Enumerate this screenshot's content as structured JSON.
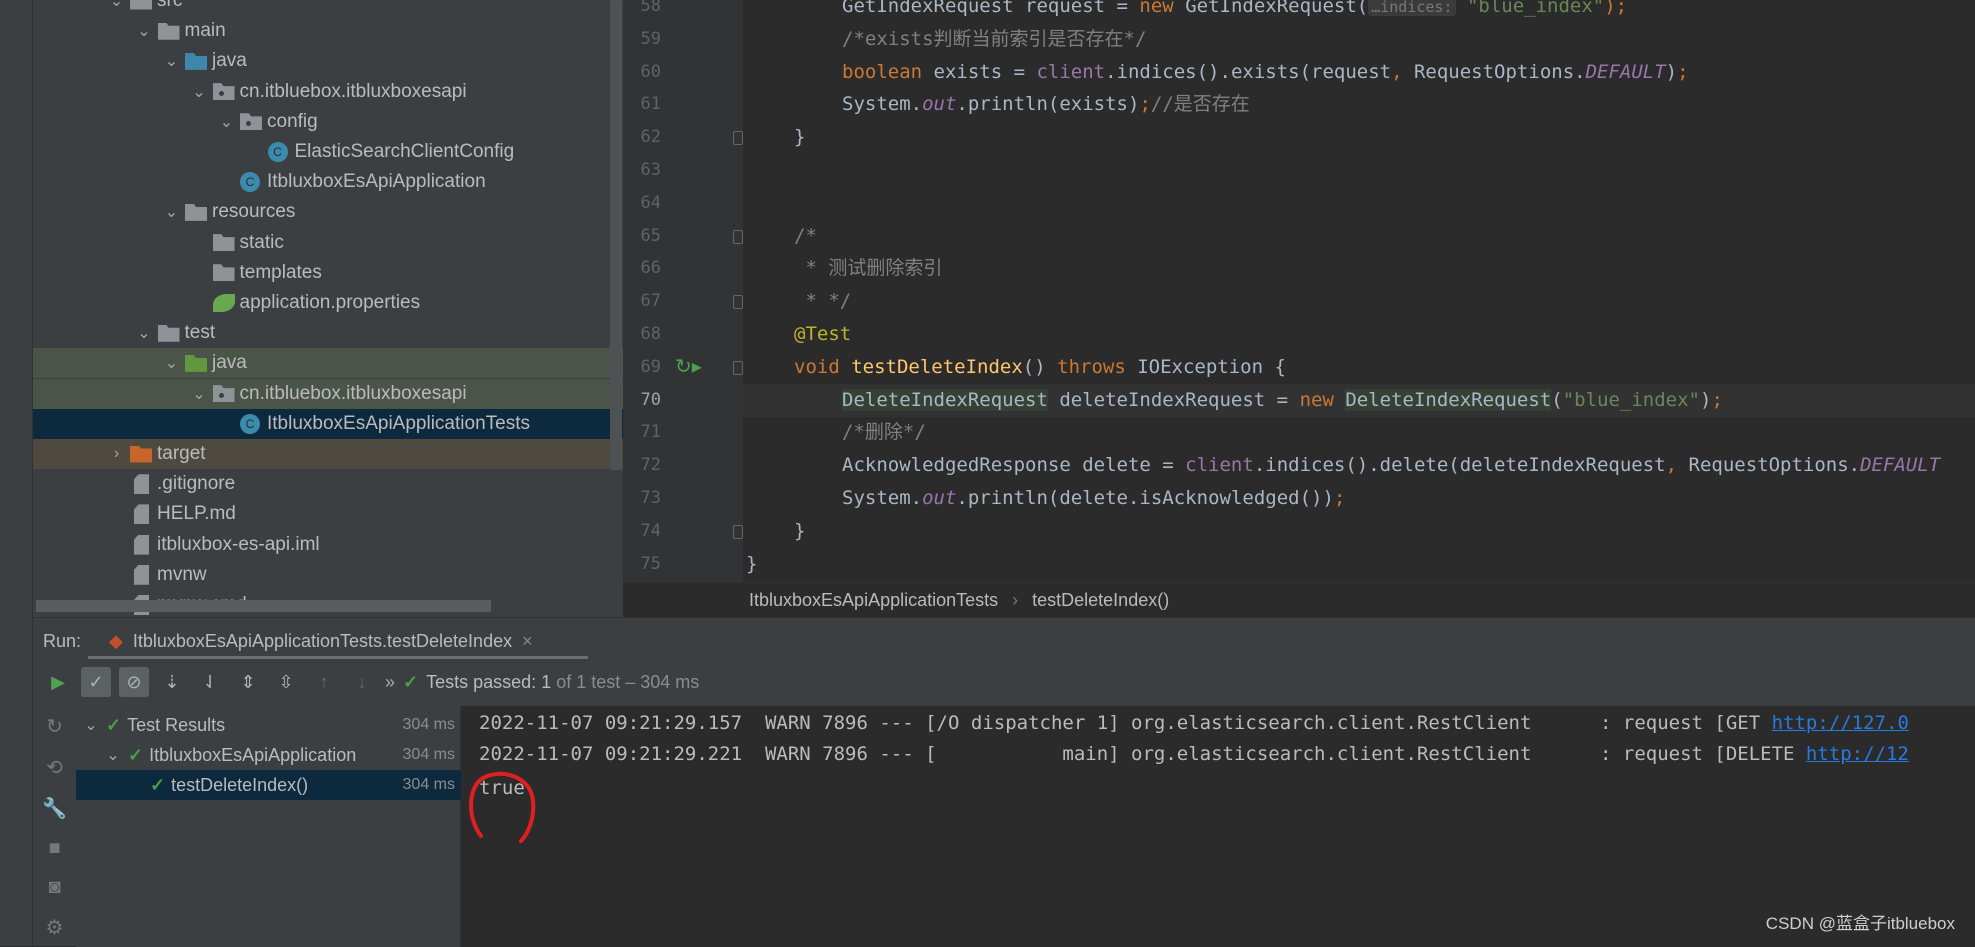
{
  "project_tree": [
    {
      "label": "src",
      "level": 0,
      "expand": "open",
      "icon": "folder"
    },
    {
      "label": "main",
      "level": 1,
      "expand": "open",
      "icon": "folder"
    },
    {
      "label": "java",
      "level": 2,
      "expand": "open",
      "icon": "folder-blue"
    },
    {
      "label": "cn.itbluebox.itbluxboxesapi",
      "level": 3,
      "expand": "open",
      "icon": "package"
    },
    {
      "label": "config",
      "level": 4,
      "expand": "open",
      "icon": "package"
    },
    {
      "label": "ElasticSearchClientConfig",
      "level": 5,
      "expand": "none",
      "icon": "class"
    },
    {
      "label": "ItbluxboxEsApiApplication",
      "level": 4,
      "expand": "none",
      "icon": "class"
    },
    {
      "label": "resources",
      "level": 2,
      "expand": "open",
      "icon": "folder"
    },
    {
      "label": "static",
      "level": 3,
      "expand": "none",
      "icon": "folder"
    },
    {
      "label": "templates",
      "level": 3,
      "expand": "none",
      "icon": "folder"
    },
    {
      "label": "application.properties",
      "level": 3,
      "expand": "none",
      "icon": "spring"
    },
    {
      "label": "test",
      "level": 1,
      "expand": "open",
      "icon": "folder"
    },
    {
      "label": "java",
      "level": 2,
      "expand": "open",
      "icon": "folder-green",
      "highlight": "green"
    },
    {
      "label": "cn.itbluebox.itbluxboxesapi",
      "level": 3,
      "expand": "open",
      "icon": "package",
      "highlight": "green"
    },
    {
      "label": "ItbluxboxEsApiApplicationTests",
      "level": 4,
      "expand": "none",
      "icon": "class",
      "highlight": "sel"
    },
    {
      "label": "target",
      "level": 0,
      "expand": "closed",
      "icon": "folder-orange",
      "highlight": "excl"
    },
    {
      "label": ".gitignore",
      "level": 0,
      "expand": "none",
      "icon": "file"
    },
    {
      "label": "HELP.md",
      "level": 0,
      "expand": "none",
      "icon": "file"
    },
    {
      "label": "itbluxbox-es-api.iml",
      "level": 0,
      "expand": "none",
      "icon": "file"
    },
    {
      "label": "mvnw",
      "level": 0,
      "expand": "none",
      "icon": "file"
    },
    {
      "label": "mvnw.cmd",
      "level": 0,
      "expand": "none",
      "icon": "file"
    }
  ],
  "editor": {
    "current_line": 70,
    "lines": [
      {
        "n": 58,
        "indent": 2,
        "tokens": [
          [
            "GetIndexRequest request = ",
            ""
          ],
          [
            "new ",
            "kw"
          ],
          [
            "GetIndexRequest(",
            ""
          ],
          [
            "…indices:",
            "hint"
          ],
          [
            " ",
            ""
          ],
          [
            "\"blue_index\"",
            "str"
          ],
          [
            ");",
            "kw"
          ]
        ]
      },
      {
        "n": 59,
        "indent": 2,
        "tokens": [
          [
            "/*exists判断当前索引是否存在*/",
            "cm"
          ]
        ]
      },
      {
        "n": 60,
        "indent": 2,
        "tokens": [
          [
            "boolean ",
            "kw"
          ],
          [
            "exists = ",
            ""
          ],
          [
            "client",
            "fld"
          ],
          [
            ".indices().exists(request",
            ""
          ],
          [
            ", ",
            "kw"
          ],
          [
            "RequestOptions.",
            ""
          ],
          [
            "DEFAULT",
            "fldi"
          ],
          [
            ")",
            ""
          ],
          [
            ";",
            "kw"
          ]
        ]
      },
      {
        "n": 61,
        "indent": 2,
        "tokens": [
          [
            "System.",
            ""
          ],
          [
            "out",
            "fldi"
          ],
          [
            ".println(exists)",
            ""
          ],
          [
            ";",
            "kw"
          ],
          [
            "//是否存在",
            "cm"
          ]
        ]
      },
      {
        "n": 62,
        "indent": 1,
        "fold": true,
        "tokens": [
          [
            "}",
            ""
          ]
        ]
      },
      {
        "n": 63,
        "indent": 0,
        "tokens": []
      },
      {
        "n": 64,
        "indent": 0,
        "tokens": []
      },
      {
        "n": 65,
        "indent": 1,
        "fold": true,
        "tokens": [
          [
            "/*",
            "cm"
          ]
        ]
      },
      {
        "n": 66,
        "indent": 1,
        "tokens": [
          [
            " * 测试删除索引",
            "cm"
          ]
        ]
      },
      {
        "n": 67,
        "indent": 1,
        "fold": true,
        "tokens": [
          [
            " * */",
            "cm"
          ]
        ]
      },
      {
        "n": 68,
        "indent": 1,
        "tokens": [
          [
            "@Test",
            "ann"
          ]
        ]
      },
      {
        "n": 69,
        "indent": 1,
        "fold": true,
        "run": true,
        "tokens": [
          [
            "void ",
            "kw"
          ],
          [
            "testDeleteIndex",
            "meth"
          ],
          [
            "() ",
            ""
          ],
          [
            "throws ",
            "kw"
          ],
          [
            "IOException {",
            ""
          ]
        ]
      },
      {
        "n": 70,
        "indent": 2,
        "bulb": true,
        "tokens": [
          [
            "DeleteIndexRequest",
            "ref"
          ],
          [
            " deleteIndexRequest = ",
            ""
          ],
          [
            "new ",
            "kw"
          ],
          [
            "DeleteIndexRequest",
            "ref"
          ],
          [
            "(",
            ""
          ],
          [
            "\"blue_index\"",
            "str"
          ],
          [
            ")",
            ""
          ],
          [
            ";",
            "kw"
          ]
        ]
      },
      {
        "n": 71,
        "indent": 2,
        "tokens": [
          [
            "/*删除*/",
            "cm"
          ]
        ]
      },
      {
        "n": 72,
        "indent": 2,
        "tokens": [
          [
            "AcknowledgedResponse delete = ",
            ""
          ],
          [
            "client",
            "fld"
          ],
          [
            ".indices().delete(deleteIndexRequest",
            ""
          ],
          [
            ", ",
            "kw"
          ],
          [
            "RequestOptions.",
            ""
          ],
          [
            "DEFAULT",
            "fldi"
          ]
        ]
      },
      {
        "n": 73,
        "indent": 2,
        "tokens": [
          [
            "System.",
            ""
          ],
          [
            "out",
            "fldi"
          ],
          [
            ".println(delete.isAcknowledged())",
            ""
          ],
          [
            ";",
            "kw"
          ]
        ]
      },
      {
        "n": 74,
        "indent": 1,
        "fold": true,
        "tokens": [
          [
            "}",
            ""
          ]
        ]
      },
      {
        "n": 75,
        "indent": 0,
        "tokens": [
          [
            "}",
            ""
          ]
        ]
      }
    ]
  },
  "breadcrumb": [
    "ItbluxboxEsApiApplicationTests",
    "testDeleteIndex()"
  ],
  "run": {
    "label": "Run:",
    "tab": "ItbluxboxEsApiApplicationTests.testDeleteIndex",
    "status_prefix": "Tests passed:",
    "status_count": "1",
    "status_rest": "of 1 test – 304 ms",
    "tree": [
      {
        "label": "Test Results",
        "duration": "304 ms",
        "level": 0
      },
      {
        "label": "ItbluxboxEsApiApplication",
        "duration": "304 ms",
        "level": 1
      },
      {
        "label": "testDeleteIndex()",
        "duration": "304 ms",
        "level": 2,
        "selected": true
      }
    ],
    "console": [
      {
        "text": "2022-11-07 09:21:29.157  WARN 7896 --- [/O dispatcher 1] org.elasticsearch.client.RestClient      : request [GET ",
        "link": "http://127.0"
      },
      {
        "text": "2022-11-07 09:21:29.221  WARN 7896 --- [           main] org.elasticsearch.client.RestClient      : request [DELETE ",
        "link": "http://12"
      },
      {
        "text": "true",
        "link": ""
      }
    ]
  },
  "watermark": "CSDN @蓝盒子itbluebox",
  "colors": {
    "keyword": "#cc7832",
    "string": "#6a8759",
    "comment": "#808080",
    "annotation": "#bbb529",
    "field": "#9876aa",
    "method": "#ffc66d",
    "pass": "#4a9f4a",
    "annotation_circle": "#e02020"
  }
}
